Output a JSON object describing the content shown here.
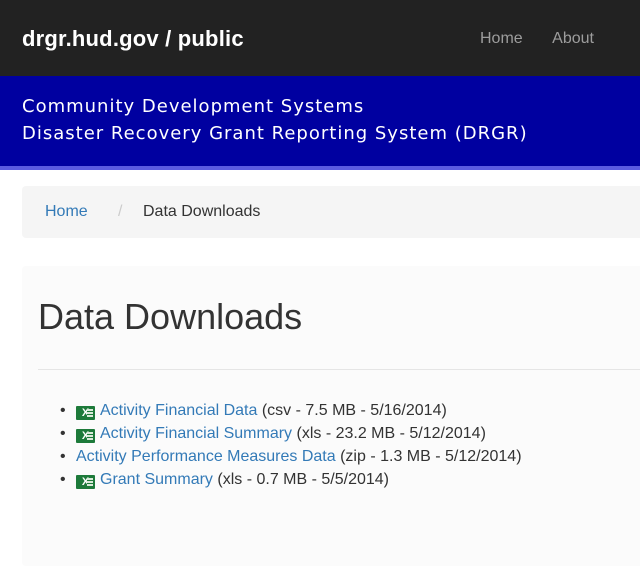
{
  "navbar": {
    "brand": "drgr.hud.gov / public",
    "links": [
      "Home",
      "About"
    ]
  },
  "banner": {
    "line1": "Community Development Systems",
    "line2": "Disaster Recovery Grant Reporting System (DRGR)"
  },
  "breadcrumb": {
    "home": "Home",
    "separator": "/",
    "current": "Data Downloads"
  },
  "page": {
    "title": "Data Downloads"
  },
  "downloads": [
    {
      "icon": "excel-icon",
      "label": "Activity Financial Data",
      "meta": " (csv - 7.5 MB - 5/16/2014)"
    },
    {
      "icon": "excel-icon",
      "label": "Activity Financial Summary",
      "meta": " (xls - 23.2 MB - 5/12/2014)"
    },
    {
      "icon": "",
      "label": "Activity Performance Measures Data",
      "meta": " (zip - 1.3 MB - 5/12/2014)"
    },
    {
      "icon": "excel-icon",
      "label": "Grant Summary",
      "meta": " (xls - 0.7 MB - 5/5/2014)"
    }
  ],
  "colors": {
    "navbar": "#222222",
    "banner": "#0000a0",
    "link": "#337ab7",
    "excel_icon": "#1d7a3a"
  }
}
